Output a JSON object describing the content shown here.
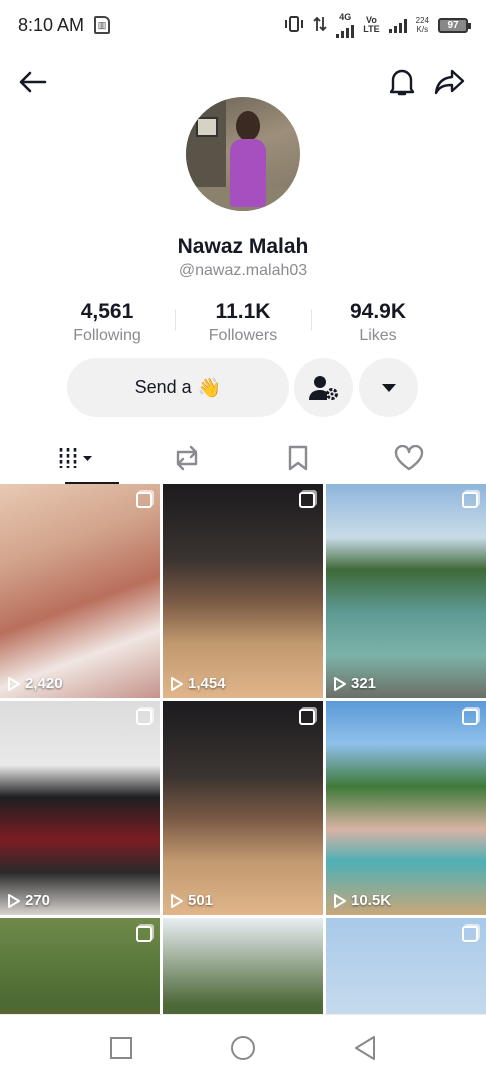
{
  "status_bar": {
    "time": "8:10 AM",
    "network_4g": "4G",
    "volte_top": "Vo",
    "volte_bottom": "LTE",
    "speed_value": "224",
    "speed_unit": "K/s",
    "battery": "97"
  },
  "profile": {
    "name": "Nawaz Malah",
    "handle": "@nawaz.malah03",
    "stats": [
      {
        "value": "4,561",
        "label": "Following"
      },
      {
        "value": "11.1K",
        "label": "Followers"
      },
      {
        "value": "94.9K",
        "label": "Likes"
      }
    ],
    "send_label": "Send a",
    "send_emoji": "👋"
  },
  "tabs": [
    {
      "icon": "videos-grid-icon"
    },
    {
      "icon": "repost-icon"
    },
    {
      "icon": "bookmark-icon"
    },
    {
      "icon": "heart-icon"
    }
  ],
  "videos": [
    {
      "views": "2,420"
    },
    {
      "views": "1,454"
    },
    {
      "views": "321"
    },
    {
      "views": "270"
    },
    {
      "views": "501"
    },
    {
      "views": "10.5K"
    },
    {
      "views": ""
    },
    {
      "views": ""
    },
    {
      "views": ""
    }
  ],
  "colors": {
    "text_primary": "#161823",
    "text_secondary": "#8a8b91",
    "button_bg": "#f1f1f2"
  }
}
